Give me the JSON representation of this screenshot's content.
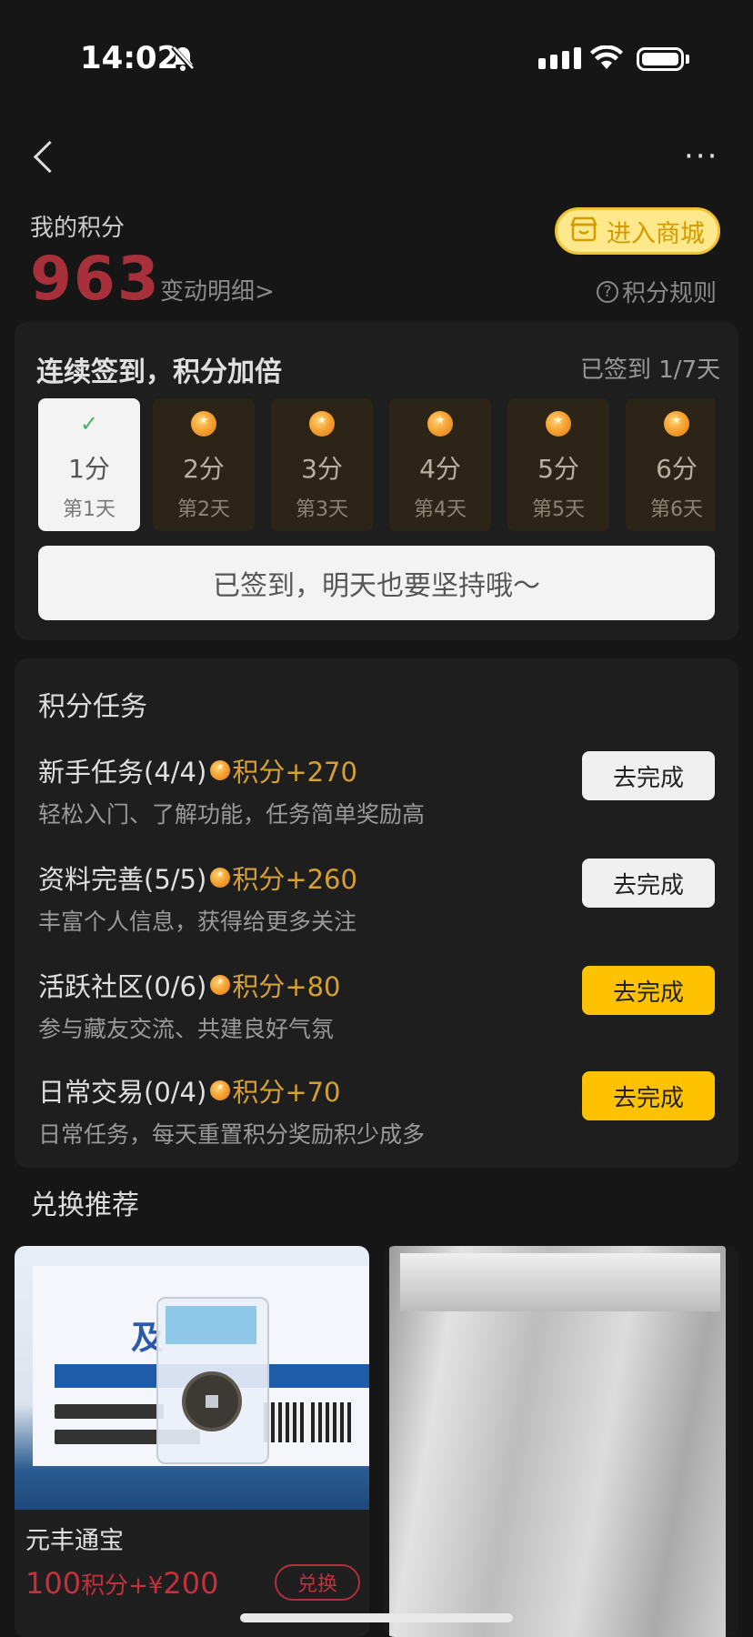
{
  "status_bar": {
    "time": "14:02"
  },
  "header": {
    "my_points_label": "我的积分",
    "points": "963",
    "detail_link": "变动明细>",
    "mall_button": "进入商城",
    "rules_link": "积分规则"
  },
  "signin": {
    "title": "连续签到，积分加倍",
    "count": "已签到 1/7天",
    "days": [
      {
        "points": "1分",
        "day": "第1天",
        "signed": true
      },
      {
        "points": "2分",
        "day": "第2天",
        "signed": false
      },
      {
        "points": "3分",
        "day": "第3天",
        "signed": false
      },
      {
        "points": "4分",
        "day": "第4天",
        "signed": false
      },
      {
        "points": "5分",
        "day": "第5天",
        "signed": false
      },
      {
        "points": "6分",
        "day": "第6天",
        "signed": false
      }
    ],
    "button": "已签到，明天也要坚持哦～"
  },
  "tasks": {
    "title": "积分任务",
    "items": [
      {
        "name": "新手任务(4/4)",
        "reward": "积分+270",
        "desc": "轻松入门、了解功能，任务简单奖励高",
        "button": "去完成",
        "active": false
      },
      {
        "name": "资料完善(5/5)",
        "reward": "积分+260",
        "desc": "丰富个人信息，获得给更多关注",
        "button": "去完成",
        "active": false
      },
      {
        "name": "活跃社区(0/6)",
        "reward": "积分+80",
        "desc": "参与藏友交流、共建良好气氛",
        "button": "去完成",
        "active": true
      },
      {
        "name": "日常交易(0/4)",
        "reward": "积分+70",
        "desc": "日常任务，每天重置积分奖励积少成多",
        "button": "去完成",
        "active": true
      }
    ]
  },
  "exchange": {
    "title": "兑换推荐",
    "products": [
      {
        "name": "元丰通宝",
        "price_points": "100",
        "price_unit": "积分+¥",
        "price_cash": "200",
        "button": "兑换"
      }
    ]
  },
  "colors": {
    "accent_yellow": "#fec200",
    "points_red": "#a8303a",
    "reward_gold": "#d7a033"
  }
}
